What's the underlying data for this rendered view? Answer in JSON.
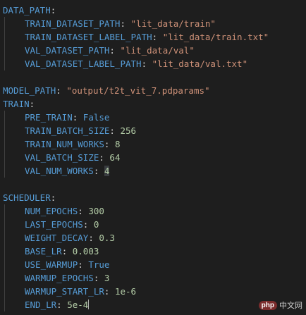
{
  "code_lines": [
    {
      "key": "DATA_PATH",
      "indent": 0
    },
    {
      "key": "TRAIN_DATASET_PATH",
      "indent": 1,
      "value": "\"lit_data/train\"",
      "type": "string"
    },
    {
      "key": "TRAIN_DATASET_LABEL_PATH",
      "indent": 1,
      "value": "\"lit_data/train.txt\"",
      "type": "string"
    },
    {
      "key": "VAL_DATASET_PATH",
      "indent": 1,
      "value": "\"lit_data/val\"",
      "type": "string"
    },
    {
      "key": "VAL_DATASET_LABEL_PATH",
      "indent": 1,
      "value": "\"lit_data/val.txt\"",
      "type": "string"
    },
    {
      "blank": true
    },
    {
      "key": "MODEL_PATH",
      "indent": 0,
      "value": "\"output/t2t_vit_7.pdparams\"",
      "type": "string"
    },
    {
      "key": "TRAIN",
      "indent": 0
    },
    {
      "key": "PRE_TRAIN",
      "indent": 1,
      "value": "False",
      "type": "keyword"
    },
    {
      "key": "TRAIN_BATCH_SIZE",
      "indent": 1,
      "value": "256",
      "type": "number"
    },
    {
      "key": "TRAIN_NUM_WORKS",
      "indent": 1,
      "value": "8",
      "type": "number"
    },
    {
      "key": "VAL_BATCH_SIZE",
      "indent": 1,
      "value": "64",
      "type": "number"
    },
    {
      "key": "VAL_NUM_WORKS",
      "indent": 1,
      "value": "4",
      "type": "number",
      "highlight": true
    },
    {
      "blank": true
    },
    {
      "key": "SCHEDULER",
      "indent": 0
    },
    {
      "key": "NUM_EPOCHS",
      "indent": 1,
      "value": "300",
      "type": "number"
    },
    {
      "key": "LAST_EPOCHS",
      "indent": 1,
      "value": "0",
      "type": "number"
    },
    {
      "key": "WEIGHT_DECAY",
      "indent": 1,
      "value": "0.3",
      "type": "number"
    },
    {
      "key": "BASE_LR",
      "indent": 1,
      "value": "0.003",
      "type": "number"
    },
    {
      "key": "USE_WARMUP",
      "indent": 1,
      "value": "True",
      "type": "keyword"
    },
    {
      "key": "WARMUP_EPOCHS",
      "indent": 1,
      "value": "3",
      "type": "number"
    },
    {
      "key": "WARMUP_START_LR",
      "indent": 1,
      "value": "1e-6",
      "type": "number"
    },
    {
      "key": "END_LR",
      "indent": 1,
      "value": "5e-4",
      "type": "number",
      "cursor": true
    }
  ],
  "watermark": {
    "badge": "php",
    "text": "中文网"
  },
  "colors": {
    "background": "#1e1e1e",
    "key": "#569cd6",
    "string": "#ce9178",
    "number": "#b5cea8",
    "punctuation": "#d4d4d4"
  }
}
